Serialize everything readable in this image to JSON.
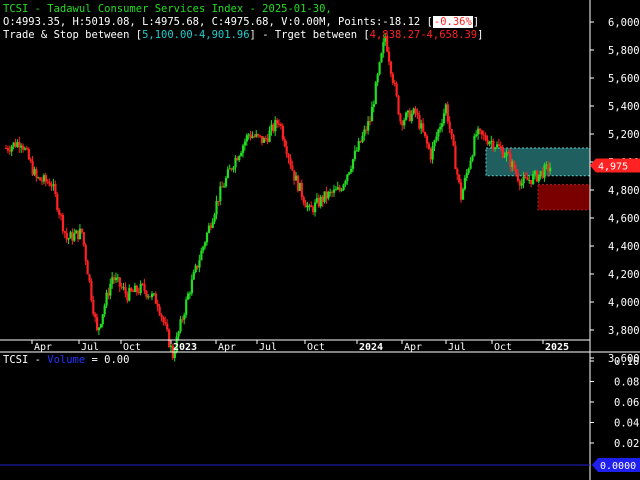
{
  "header": {
    "title_line": "TCSI - Tadawul Consumer Services Index - 2025-01-30,",
    "ohlc_line": "O:4993.35, H:5019.08, L:4975.68, C:4975.68, V:0.00M, Points:-18.12 [",
    "pct_change": "-0.36%",
    "bracket_close": "]",
    "trade_label": "Trade & Stop between [",
    "trade_range": "5,100.00-4,901.96",
    "target_label": "] - Trget between [",
    "target_range": "4,838.27-4,658.39",
    "target_close": "]"
  },
  "volume_panel": {
    "label_prefix": "TCSI - ",
    "label_name": "Volume",
    "label_value": " = 0.00",
    "y_ticks": [
      "0.10",
      "0.08",
      "0.06",
      "0.04",
      "0.02"
    ],
    "current_value": "0.0000"
  },
  "colors": {
    "up": "#22dd22",
    "down": "#ff2222",
    "trade_zone": "#1f5f5f",
    "target_zone": "#7a0000",
    "axis": "#ffffff",
    "volume_line": "#1f1fcc"
  },
  "chart_data": {
    "type": "candlestick",
    "symbol": "TCSI",
    "x_tick_labels": [
      "Apr",
      "Jul",
      "Oct",
      "2023",
      "Apr",
      "Jul",
      "Oct",
      "2024",
      "Apr",
      "Jul",
      "Oct",
      "2025"
    ],
    "y_tick_labels": [
      "6,000",
      "5,800",
      "5,600",
      "5,400",
      "5,200",
      "5,000",
      "4,800",
      "4,600",
      "4,400",
      "4,200",
      "4,000",
      "3,800",
      "3,600"
    ],
    "ylim": [
      3500,
      6100
    ],
    "last_price": "4,975",
    "trade_zone": [
      4901.96,
      5100.0
    ],
    "target_zone": [
      4658.39,
      4838.27
    ],
    "series": [
      {
        "date": "2022-01",
        "close": 5100
      },
      {
        "date": "2022-02",
        "close": 5150
      },
      {
        "date": "2022-03",
        "close": 4880
      },
      {
        "date": "2022-04",
        "close": 4850
      },
      {
        "date": "2022-05",
        "close": 4450
      },
      {
        "date": "2022-06",
        "close": 4500
      },
      {
        "date": "2022-07",
        "close": 3780
      },
      {
        "date": "2022-08",
        "close": 4180
      },
      {
        "date": "2022-09",
        "close": 4050
      },
      {
        "date": "2022-10",
        "close": 4100
      },
      {
        "date": "2022-11",
        "close": 4000
      },
      {
        "date": "2022-12",
        "close": 3620
      },
      {
        "date": "2023-01",
        "close": 4050
      },
      {
        "date": "2023-02",
        "close": 4400
      },
      {
        "date": "2023-03",
        "close": 4750
      },
      {
        "date": "2023-04",
        "close": 5000
      },
      {
        "date": "2023-05",
        "close": 5200
      },
      {
        "date": "2023-06",
        "close": 5150
      },
      {
        "date": "2023-07",
        "close": 5300
      },
      {
        "date": "2023-08",
        "close": 4900
      },
      {
        "date": "2023-09",
        "close": 4650
      },
      {
        "date": "2023-10",
        "close": 4750
      },
      {
        "date": "2023-11",
        "close": 4800
      },
      {
        "date": "2023-12",
        "close": 5050
      },
      {
        "date": "2024-01",
        "close": 5300
      },
      {
        "date": "2024-02",
        "close": 5900
      },
      {
        "date": "2024-03",
        "close": 5300
      },
      {
        "date": "2024-04",
        "close": 5350
      },
      {
        "date": "2024-05",
        "close": 5050
      },
      {
        "date": "2024-06",
        "close": 5400
      },
      {
        "date": "2024-07",
        "close": 4750
      },
      {
        "date": "2024-08",
        "close": 5200
      },
      {
        "date": "2024-09",
        "close": 5150
      },
      {
        "date": "2024-10",
        "close": 5050
      },
      {
        "date": "2024-11",
        "close": 4850
      },
      {
        "date": "2024-12",
        "close": 4900
      },
      {
        "date": "2025-01",
        "close": 4975
      }
    ]
  }
}
